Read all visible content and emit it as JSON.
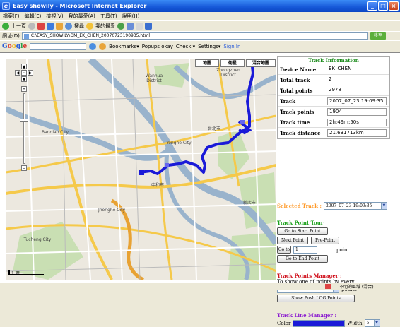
{
  "window": {
    "title": "Easy showily - Microsoft Internet Explorer"
  },
  "menu": [
    "檔案(F)",
    "編輯(E)",
    "檢視(V)",
    "我的最愛(A)",
    "工具(T)",
    "說明(H)"
  ],
  "toolbar": {
    "back": "上一頁",
    "search": "搜尋",
    "favorites": "我的最愛"
  },
  "address": {
    "label": "網址(D)",
    "url": "C:\\EASY_SHOWILY\\OM_EK_CHEN_20070723190935.html",
    "go": "移至"
  },
  "googlebar": {
    "logo": "Google",
    "bookmarks": "Bookmarks▾",
    "popups": "Popups okay",
    "check": "Check ▾",
    "settings": "Settings▾",
    "signin": "Sign In"
  },
  "map": {
    "types": [
      "地圖",
      "衛星",
      "混合地圖"
    ],
    "labels": [
      "Wanhua District",
      "Zhongzhen District",
      "Banqiao City",
      "Yonghe City",
      "中和市",
      "Tucheng City",
      "Jhonghe City",
      "台北市",
      "新店市"
    ],
    "scale": "1 哩"
  },
  "info": {
    "title": "Track Information",
    "rows": [
      {
        "label": "Device Name",
        "value": "EK_CHEN"
      },
      {
        "label": "Total track",
        "value": "2"
      },
      {
        "label": "Total points",
        "value": "2978"
      },
      {
        "label": "Track",
        "value": "2007_07_23 19:09:35"
      },
      {
        "label": "Track points",
        "value": "1904"
      },
      {
        "label": "Track time",
        "value": "2h:49m:50s"
      },
      {
        "label": "Track distance",
        "value": "21.631713km"
      }
    ]
  },
  "selected_track": {
    "label": "Selected Track :",
    "value": "2007_07_23 19:09:35"
  },
  "tour": {
    "title": "Track Point Tour",
    "start": "Go to Start Point",
    "next": "Next Point",
    "pre": "Pre-Point",
    "goto": "Go to",
    "goto_value": "1",
    "point": "point",
    "end": "Go to End Point"
  },
  "manager": {
    "title": "Track Points Manager :",
    "desc": "To show one of points by every",
    "every": "5",
    "points": "points",
    "push": "Show Push LOG Points"
  },
  "line": {
    "title": "Track Line Manager :",
    "color_label": "Color",
    "width_label": "Width",
    "width": "5"
  },
  "status": {
    "zone": "不明的區域 (混合)"
  },
  "colors": {
    "track": "#1a1ad8",
    "title_green": "#1a8a1a",
    "orange": "#ff9a2a"
  }
}
